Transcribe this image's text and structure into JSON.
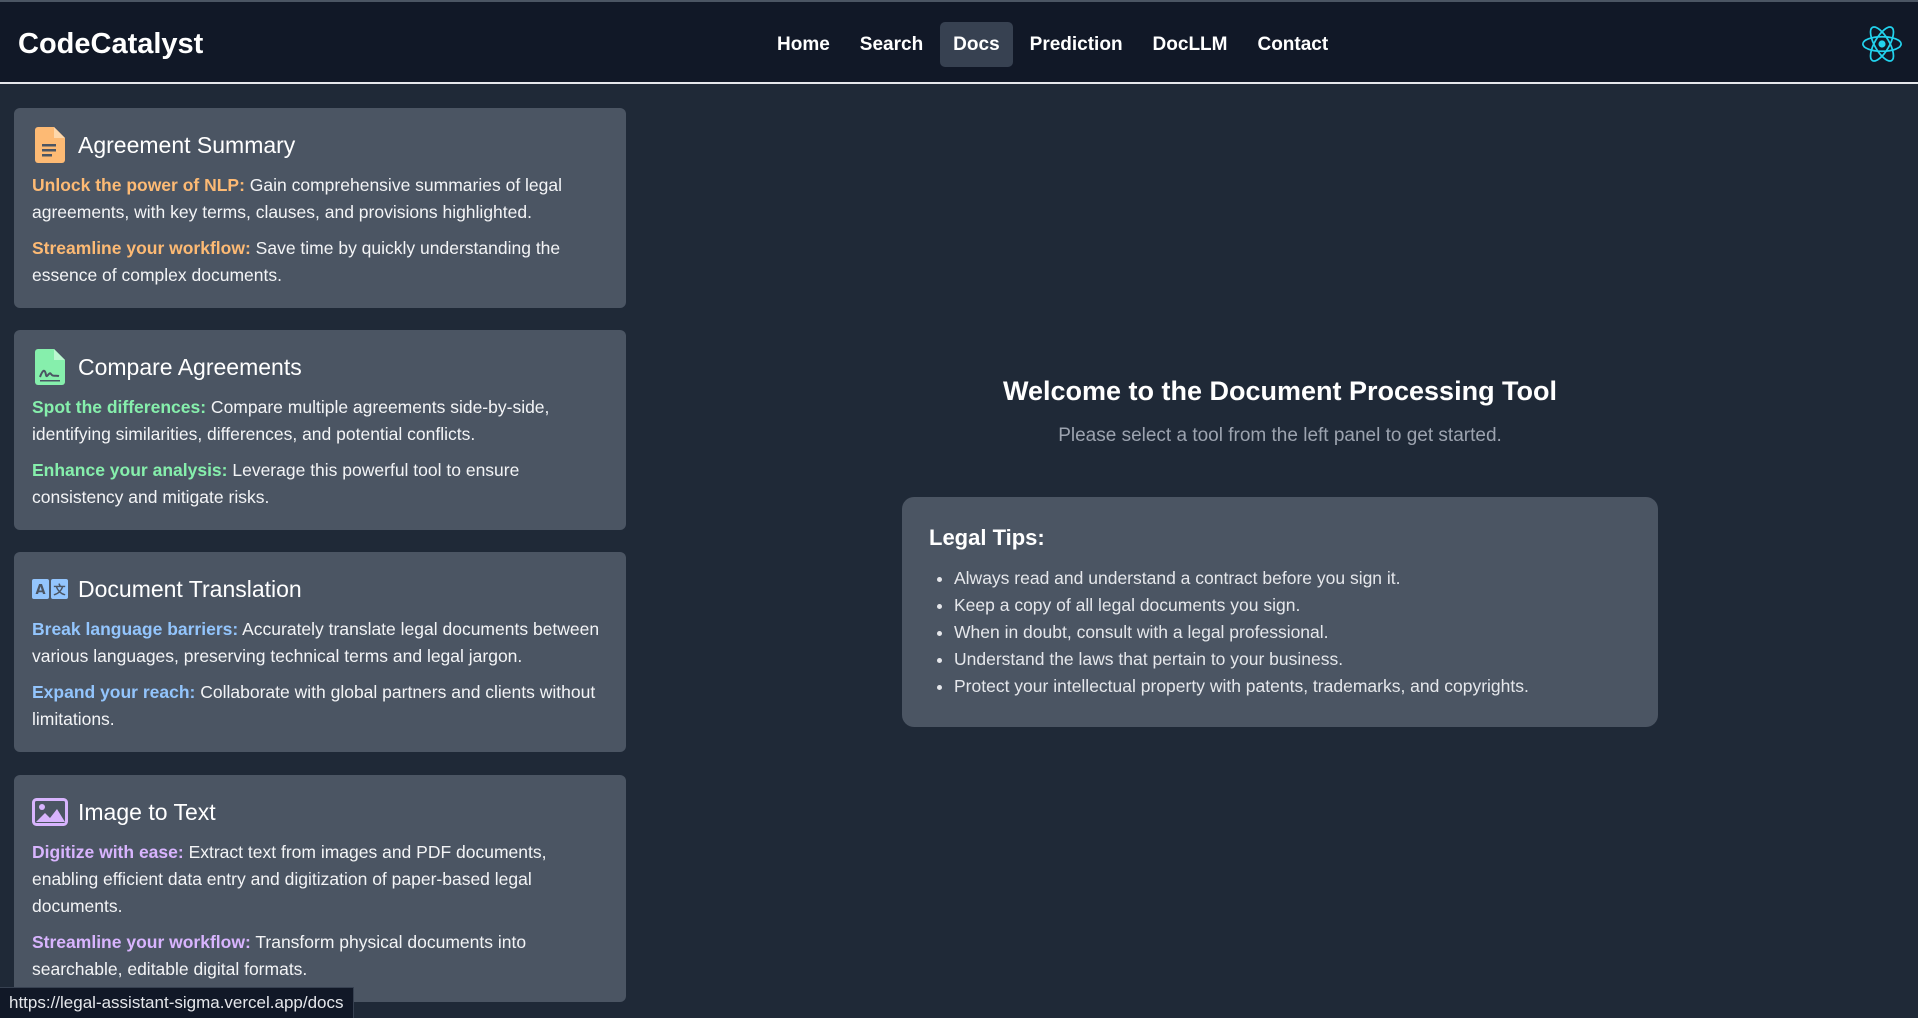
{
  "nav": {
    "brand": "CodeCatalyst",
    "links": [
      {
        "label": "Home"
      },
      {
        "label": "Search"
      },
      {
        "label": "Docs"
      },
      {
        "label": "Prediction"
      },
      {
        "label": "DocLLM"
      },
      {
        "label": "Contact"
      }
    ],
    "active": "Docs"
  },
  "tools": [
    {
      "icon": "document-icon",
      "color": "#fdba74",
      "title": "Agreement Summary",
      "paras": [
        {
          "highlight": "Unlock the power of NLP:",
          "text": " Gain comprehensive summaries of legal agreements, with key terms, clauses, and provisions highlighted."
        },
        {
          "highlight": "Streamline your workflow:",
          "text": " Save time by quickly understanding the essence of complex documents."
        }
      ]
    },
    {
      "icon": "signed-document-icon",
      "color": "#86efac",
      "title": "Compare Agreements",
      "paras": [
        {
          "highlight": "Spot the differences:",
          "text": " Compare multiple agreements side-by-side, identifying similarities, differences, and potential conflicts."
        },
        {
          "highlight": "Enhance your analysis:",
          "text": " Leverage this powerful tool to ensure consistency and mitigate risks."
        }
      ]
    },
    {
      "icon": "translate-icon",
      "color": "#93c5fd",
      "title": "Document Translation",
      "paras": [
        {
          "highlight": "Break language barriers:",
          "text": " Accurately translate legal documents between various languages, preserving technical terms and legal jargon."
        },
        {
          "highlight": "Expand your reach:",
          "text": " Collaborate with global partners and clients without limitations."
        }
      ]
    },
    {
      "icon": "image-icon",
      "color": "#d8b4fe",
      "title": "Image to Text",
      "paras": [
        {
          "highlight": "Digitize with ease:",
          "text": " Extract text from images and PDF documents, enabling efficient data entry and digitization of paper-based legal documents."
        },
        {
          "highlight": "Streamline your workflow:",
          "text": " Transform physical documents into searchable, editable digital formats."
        }
      ]
    }
  ],
  "welcome": {
    "title": "Welcome to the Document Processing Tool",
    "subtitle": "Please select a tool from the left panel to get started."
  },
  "tips": {
    "title": "Legal Tips:",
    "items": [
      "Always read and understand a contract before you sign it.",
      "Keep a copy of all legal documents you sign.",
      "When in doubt, consult with a legal professional.",
      "Understand the laws that pertain to your business.",
      "Protect your intellectual property with patents, trademarks, and copyrights."
    ]
  },
  "status_url": "https://legal-assistant-sigma.vercel.app/docs"
}
